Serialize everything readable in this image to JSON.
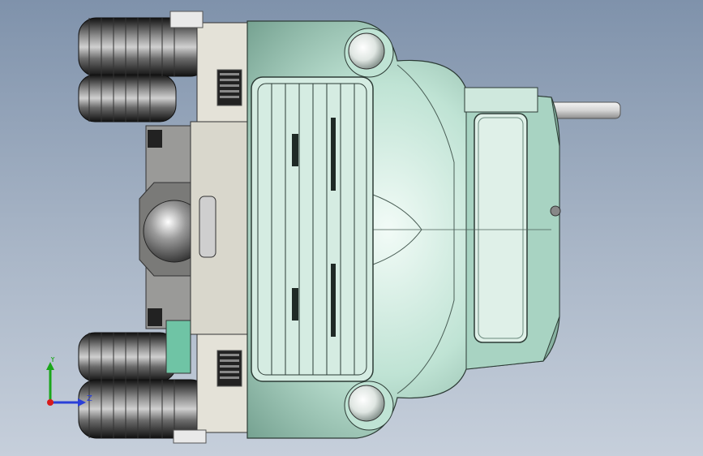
{
  "viewport": {
    "background_top": "#7f92ab",
    "background_bottom": "#c6cfdb"
  },
  "model": {
    "body_color": "#bfe3d4",
    "body_shadow": "#7fae9c",
    "metal_color": "#d8d6cf",
    "tire_color": "#2b2b2b"
  },
  "triad": {
    "y_label": "Y",
    "z_label": "Z",
    "y_color": "#1aa61a",
    "z_color": "#2a3fd8",
    "x_color": "#d81a1a"
  }
}
